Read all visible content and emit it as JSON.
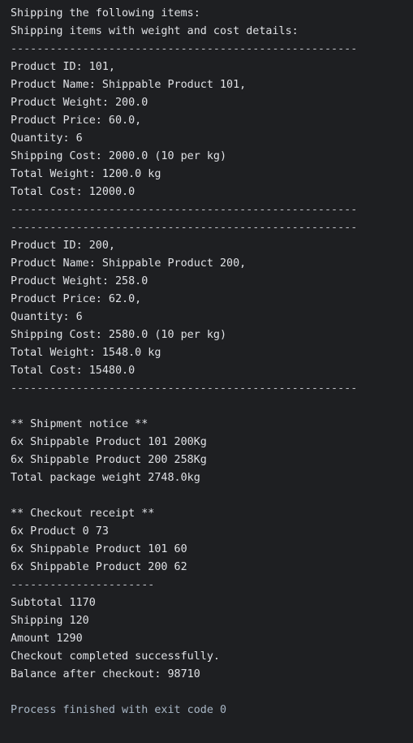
{
  "console": {
    "clipped_top_line": "............................................................",
    "lines": [
      "Shipping the following items:",
      "Shipping items with weight and cost details:",
      "-----------------------------------------------------",
      "Product ID: 101,",
      "Product Name: Shippable Product 101,",
      "Product Weight: 200.0",
      "Product Price: 60.0,",
      "Quantity: 6",
      "Shipping Cost: 2000.0 (10 per kg)",
      "Total Weight: 1200.0 kg",
      "Total Cost: 12000.0",
      "-----------------------------------------------------",
      "-----------------------------------------------------",
      "Product ID: 200,",
      "Product Name: Shippable Product 200,",
      "Product Weight: 258.0",
      "Product Price: 62.0,",
      "Quantity: 6",
      "Shipping Cost: 2580.0 (10 per kg)",
      "Total Weight: 1548.0 kg",
      "Total Cost: 15480.0",
      "-----------------------------------------------------",
      "",
      "** Shipment notice **",
      "6x Shippable Product 101 200Kg",
      "6x Shippable Product 200 258Kg",
      "Total package weight 2748.0kg",
      "",
      "** Checkout receipt **",
      "6x Product 0 73",
      "6x Shippable Product 101 60",
      "6x Shippable Product 200 62",
      "----------------------",
      "Subtotal 1170",
      "Shipping 120",
      "Amount 1290",
      "Checkout completed successfully.",
      "Balance after checkout: 98710",
      "",
      "Process finished with exit code 0"
    ]
  }
}
